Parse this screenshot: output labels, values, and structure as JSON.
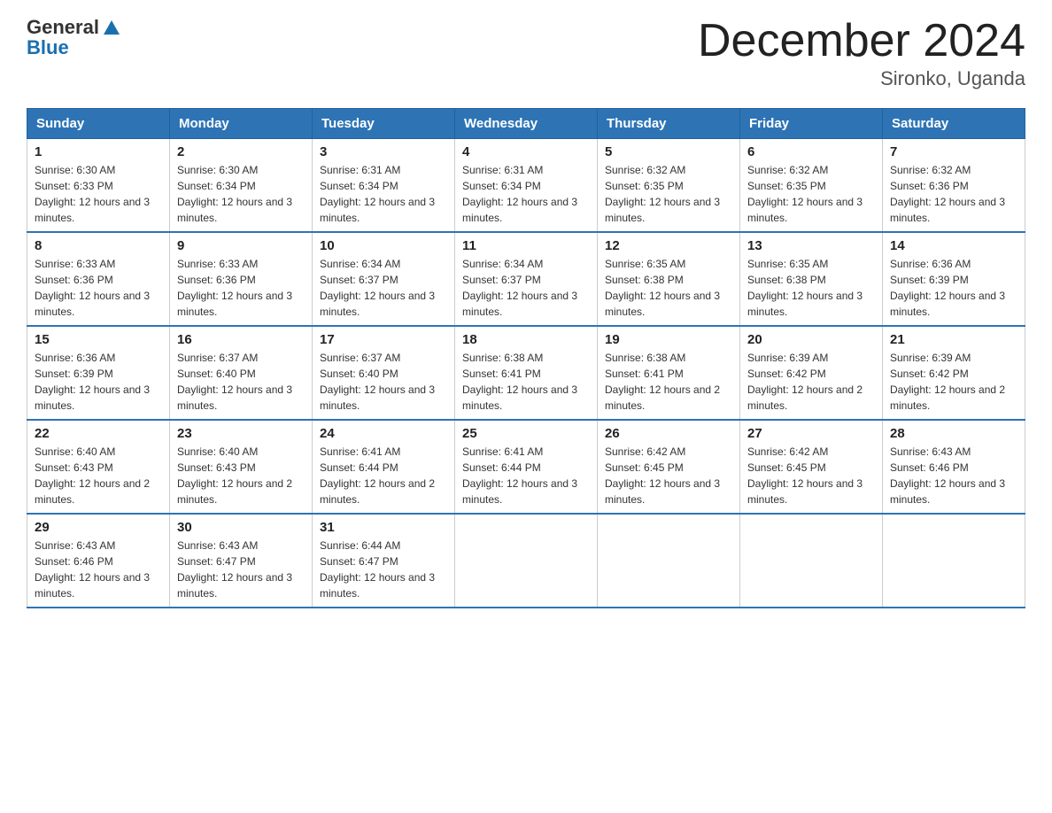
{
  "logo": {
    "line1": "General",
    "line2": "Blue"
  },
  "header": {
    "title": "December 2024",
    "subtitle": "Sironko, Uganda"
  },
  "weekdays": [
    "Sunday",
    "Monday",
    "Tuesday",
    "Wednesday",
    "Thursday",
    "Friday",
    "Saturday"
  ],
  "weeks": [
    [
      {
        "day": "1",
        "sunrise": "6:30 AM",
        "sunset": "6:33 PM",
        "daylight": "12 hours and 3 minutes."
      },
      {
        "day": "2",
        "sunrise": "6:30 AM",
        "sunset": "6:34 PM",
        "daylight": "12 hours and 3 minutes."
      },
      {
        "day": "3",
        "sunrise": "6:31 AM",
        "sunset": "6:34 PM",
        "daylight": "12 hours and 3 minutes."
      },
      {
        "day": "4",
        "sunrise": "6:31 AM",
        "sunset": "6:34 PM",
        "daylight": "12 hours and 3 minutes."
      },
      {
        "day": "5",
        "sunrise": "6:32 AM",
        "sunset": "6:35 PM",
        "daylight": "12 hours and 3 minutes."
      },
      {
        "day": "6",
        "sunrise": "6:32 AM",
        "sunset": "6:35 PM",
        "daylight": "12 hours and 3 minutes."
      },
      {
        "day": "7",
        "sunrise": "6:32 AM",
        "sunset": "6:36 PM",
        "daylight": "12 hours and 3 minutes."
      }
    ],
    [
      {
        "day": "8",
        "sunrise": "6:33 AM",
        "sunset": "6:36 PM",
        "daylight": "12 hours and 3 minutes."
      },
      {
        "day": "9",
        "sunrise": "6:33 AM",
        "sunset": "6:36 PM",
        "daylight": "12 hours and 3 minutes."
      },
      {
        "day": "10",
        "sunrise": "6:34 AM",
        "sunset": "6:37 PM",
        "daylight": "12 hours and 3 minutes."
      },
      {
        "day": "11",
        "sunrise": "6:34 AM",
        "sunset": "6:37 PM",
        "daylight": "12 hours and 3 minutes."
      },
      {
        "day": "12",
        "sunrise": "6:35 AM",
        "sunset": "6:38 PM",
        "daylight": "12 hours and 3 minutes."
      },
      {
        "day": "13",
        "sunrise": "6:35 AM",
        "sunset": "6:38 PM",
        "daylight": "12 hours and 3 minutes."
      },
      {
        "day": "14",
        "sunrise": "6:36 AM",
        "sunset": "6:39 PM",
        "daylight": "12 hours and 3 minutes."
      }
    ],
    [
      {
        "day": "15",
        "sunrise": "6:36 AM",
        "sunset": "6:39 PM",
        "daylight": "12 hours and 3 minutes."
      },
      {
        "day": "16",
        "sunrise": "6:37 AM",
        "sunset": "6:40 PM",
        "daylight": "12 hours and 3 minutes."
      },
      {
        "day": "17",
        "sunrise": "6:37 AM",
        "sunset": "6:40 PM",
        "daylight": "12 hours and 3 minutes."
      },
      {
        "day": "18",
        "sunrise": "6:38 AM",
        "sunset": "6:41 PM",
        "daylight": "12 hours and 3 minutes."
      },
      {
        "day": "19",
        "sunrise": "6:38 AM",
        "sunset": "6:41 PM",
        "daylight": "12 hours and 2 minutes."
      },
      {
        "day": "20",
        "sunrise": "6:39 AM",
        "sunset": "6:42 PM",
        "daylight": "12 hours and 2 minutes."
      },
      {
        "day": "21",
        "sunrise": "6:39 AM",
        "sunset": "6:42 PM",
        "daylight": "12 hours and 2 minutes."
      }
    ],
    [
      {
        "day": "22",
        "sunrise": "6:40 AM",
        "sunset": "6:43 PM",
        "daylight": "12 hours and 2 minutes."
      },
      {
        "day": "23",
        "sunrise": "6:40 AM",
        "sunset": "6:43 PM",
        "daylight": "12 hours and 2 minutes."
      },
      {
        "day": "24",
        "sunrise": "6:41 AM",
        "sunset": "6:44 PM",
        "daylight": "12 hours and 2 minutes."
      },
      {
        "day": "25",
        "sunrise": "6:41 AM",
        "sunset": "6:44 PM",
        "daylight": "12 hours and 3 minutes."
      },
      {
        "day": "26",
        "sunrise": "6:42 AM",
        "sunset": "6:45 PM",
        "daylight": "12 hours and 3 minutes."
      },
      {
        "day": "27",
        "sunrise": "6:42 AM",
        "sunset": "6:45 PM",
        "daylight": "12 hours and 3 minutes."
      },
      {
        "day": "28",
        "sunrise": "6:43 AM",
        "sunset": "6:46 PM",
        "daylight": "12 hours and 3 minutes."
      }
    ],
    [
      {
        "day": "29",
        "sunrise": "6:43 AM",
        "sunset": "6:46 PM",
        "daylight": "12 hours and 3 minutes."
      },
      {
        "day": "30",
        "sunrise": "6:43 AM",
        "sunset": "6:47 PM",
        "daylight": "12 hours and 3 minutes."
      },
      {
        "day": "31",
        "sunrise": "6:44 AM",
        "sunset": "6:47 PM",
        "daylight": "12 hours and 3 minutes."
      },
      null,
      null,
      null,
      null
    ]
  ]
}
